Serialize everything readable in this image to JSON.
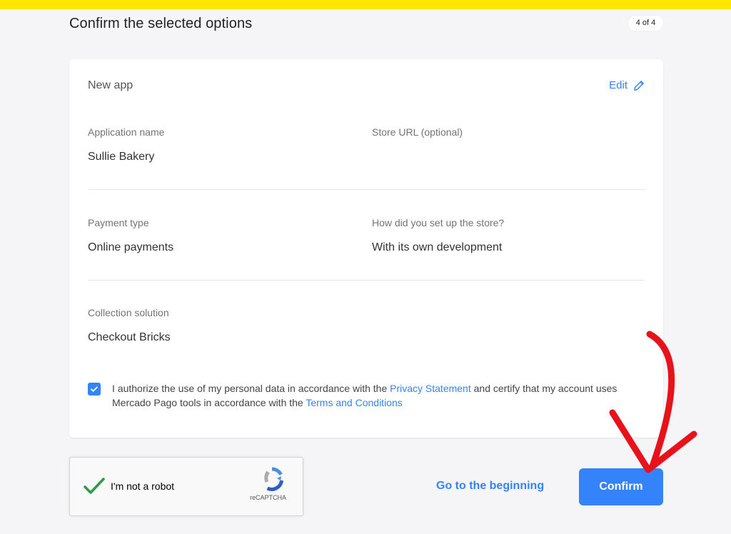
{
  "header": {
    "title": "Confirm the selected options",
    "step": "4 of 4"
  },
  "card": {
    "title": "New app",
    "edit_label": "Edit",
    "fields": {
      "application_name": {
        "label": "Application name",
        "value": "Sullie Bakery"
      },
      "store_url": {
        "label": "Store URL (optional)",
        "value": ""
      },
      "payment_type": {
        "label": "Payment type",
        "value": "Online payments"
      },
      "setup": {
        "label": "How did you set up the store?",
        "value": "With its own development"
      },
      "collection": {
        "label": "Collection solution",
        "value": "Checkout Bricks"
      }
    },
    "consent": {
      "checked": true,
      "text_1": "I authorize the use of my personal data in accordance with the ",
      "privacy_link": "Privacy Statement",
      "text_2": " and certify that my account uses Mercado Pago tools in accordance with the ",
      "terms_link": "Terms and Conditions"
    }
  },
  "recaptcha": {
    "label": "I'm not a robot",
    "brand": "reCAPTCHA",
    "checked": true
  },
  "actions": {
    "back_label": "Go to the beginning",
    "confirm_label": "Confirm"
  },
  "colors": {
    "accent": "#3483fa",
    "topbar": "#ffe600",
    "annotation": "#e8121b",
    "check_green": "#2e9b4b"
  },
  "icons": {
    "edit": "pencil-icon",
    "checkbox": "checkmark-icon",
    "recaptcha_check": "checkmark-icon",
    "recaptcha_logo": "recaptcha-logo-icon",
    "annotation": "red-arrow-annotation"
  }
}
